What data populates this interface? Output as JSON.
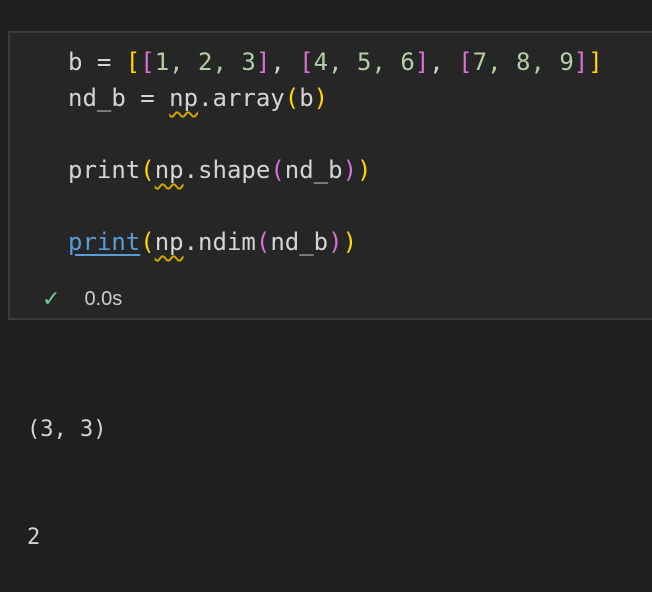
{
  "cell": {
    "lines": [
      [
        {
          "t": "b = ",
          "c": "f"
        },
        {
          "t": "[",
          "c": "y"
        },
        {
          "t": "[",
          "c": "p"
        },
        {
          "t": "1, 2, 3",
          "c": "n"
        },
        {
          "t": "]",
          "c": "p"
        },
        {
          "t": ", ",
          "c": "f"
        },
        {
          "t": "[",
          "c": "p"
        },
        {
          "t": "4, 5, 6",
          "c": "n"
        },
        {
          "t": "]",
          "c": "p"
        },
        {
          "t": ", ",
          "c": "f"
        },
        {
          "t": "[",
          "c": "p"
        },
        {
          "t": "7, 8, 9",
          "c": "n"
        },
        {
          "t": "]",
          "c": "p"
        },
        {
          "t": "]",
          "c": "y"
        }
      ],
      [
        {
          "t": "nd_b = ",
          "c": "f"
        },
        {
          "t": "np",
          "c": "f sq"
        },
        {
          "t": ".array",
          "c": "f"
        },
        {
          "t": "(",
          "c": "y"
        },
        {
          "t": "b",
          "c": "f"
        },
        {
          "t": ")",
          "c": "y"
        }
      ],
      [],
      [
        {
          "t": "print",
          "c": "f"
        },
        {
          "t": "(",
          "c": "y"
        },
        {
          "t": "np",
          "c": "f sq"
        },
        {
          "t": ".shape",
          "c": "f"
        },
        {
          "t": "(",
          "c": "p"
        },
        {
          "t": "nd_b",
          "c": "f"
        },
        {
          "t": ")",
          "c": "p"
        },
        {
          "t": ")",
          "c": "y"
        }
      ],
      [],
      [
        {
          "t": "print",
          "c": "bi"
        },
        {
          "t": "(",
          "c": "y"
        },
        {
          "t": "np",
          "c": "f sq"
        },
        {
          "t": ".ndim",
          "c": "f"
        },
        {
          "t": "(",
          "c": "p"
        },
        {
          "t": "nd_b",
          "c": "f"
        },
        {
          "t": ")",
          "c": "p"
        },
        {
          "t": ")",
          "c": "y"
        }
      ]
    ],
    "status": {
      "icon": "check-icon",
      "check": "✓",
      "time": "0.0s"
    }
  },
  "output": {
    "lines": [
      "(3, 3)",
      "2"
    ]
  },
  "colors": {
    "bracket_outer": "#ffd700",
    "bracket_inner": "#da70d6",
    "number": "#b5cea8",
    "builtin": "#569cd6",
    "success": "#73c991"
  }
}
